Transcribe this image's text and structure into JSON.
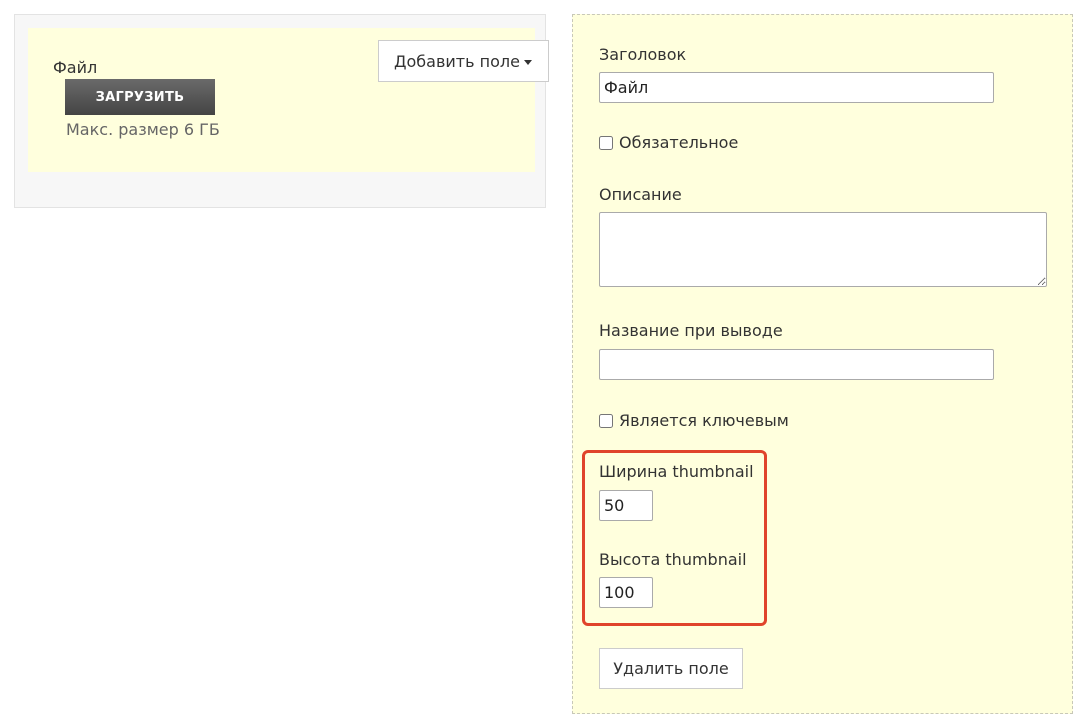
{
  "preview": {
    "field_label": "Файл",
    "upload_button": "ЗАГРУЗИТЬ",
    "size_hint": "Макс. размер 6 ГБ",
    "add_field_button": "Добавить поле"
  },
  "editor": {
    "title_label": "Заголовок",
    "title_value": "Файл",
    "required_label": "Обязательное",
    "required_checked": false,
    "description_label": "Описание",
    "description_value": "",
    "output_name_label": "Название при выводе",
    "output_name_value": "",
    "is_key_label": "Является ключевым",
    "is_key_checked": false,
    "thumb_width_label": "Ширина thumbnail",
    "thumb_width_value": "50",
    "thumb_height_label": "Высота thumbnail",
    "thumb_height_value": "100",
    "delete_button": "Удалить поле"
  },
  "colors": {
    "preview_bg": "#ffffdd",
    "panel_bg": "#f7f7f7",
    "highlight": "#e0442b",
    "upload_button_bg": "#555555"
  },
  "icons": {
    "dropdown": "caret-down-icon"
  }
}
